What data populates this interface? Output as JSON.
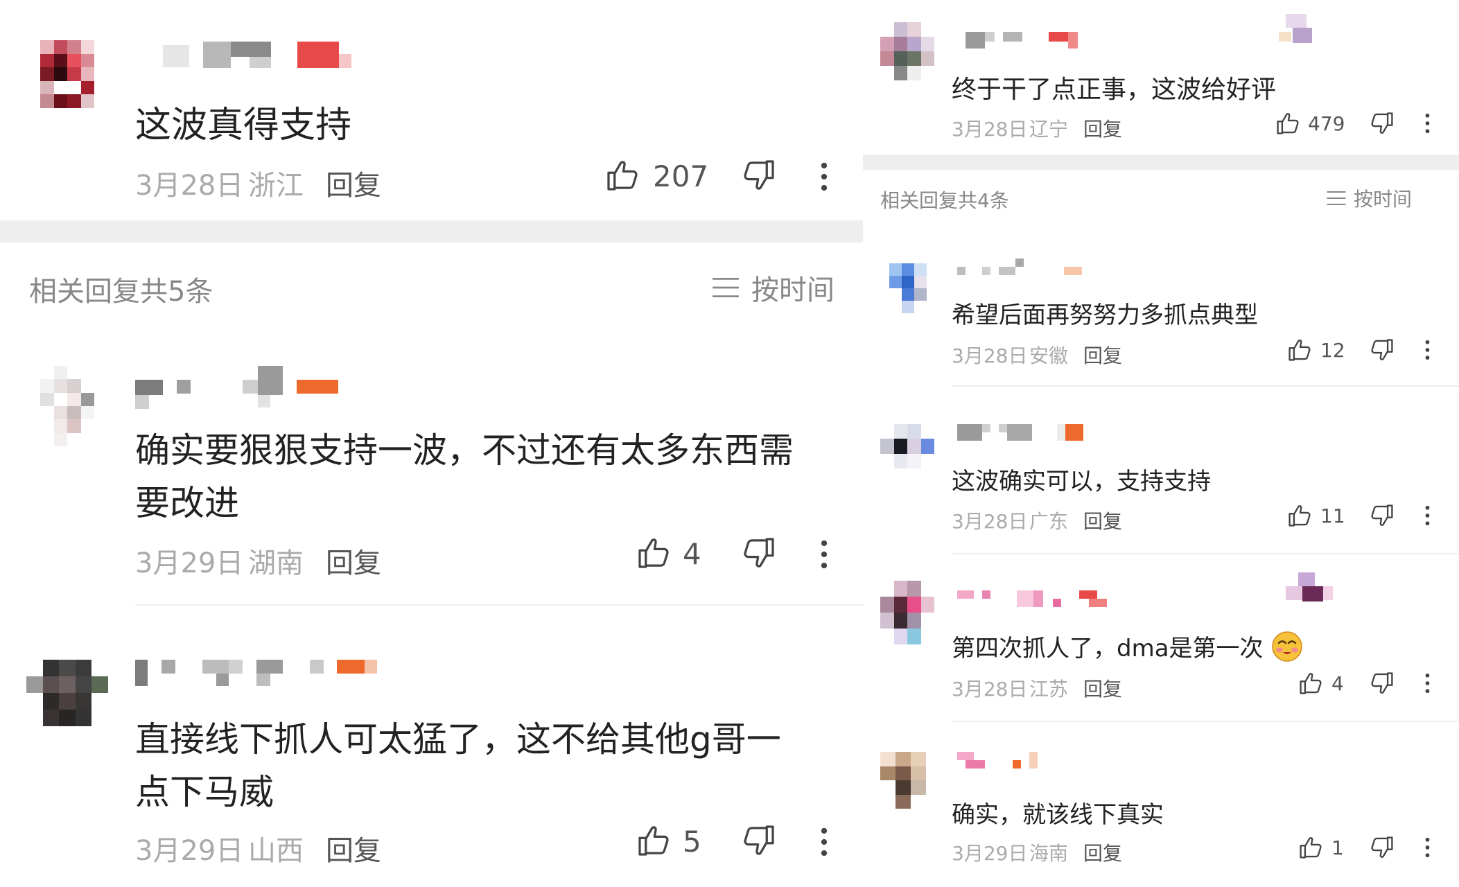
{
  "left": {
    "top_comment": {
      "text": "这波真得支持",
      "date": "3月28日",
      "location": "浙江",
      "reply": "回复",
      "likes": "207"
    },
    "section": {
      "title": "相关回复共5条",
      "sort": "按时间"
    },
    "replies": [
      {
        "text_line1": "确实要狠狠支持一波，不过还有太多东西需",
        "text_line2": "要改进",
        "date": "3月29日",
        "location": "湖南",
        "reply": "回复",
        "likes": "4"
      },
      {
        "text_line1": "直接线下抓人可太猛了，这不给其他g哥一",
        "text_line2": "点下马威",
        "date": "3月29日",
        "location": "山西",
        "reply": "回复",
        "likes": "5"
      }
    ]
  },
  "right": {
    "top_comment": {
      "text": "终于干了点正事，这波给好评",
      "date": "3月28日",
      "location": "辽宁",
      "reply": "回复",
      "likes": "479"
    },
    "section": {
      "title": "相关回复共4条",
      "sort": "按时间"
    },
    "replies": [
      {
        "text": "希望后面再努努力多抓点典型",
        "date": "3月28日",
        "location": "安徽",
        "reply": "回复",
        "likes": "12"
      },
      {
        "text": "这波确实可以，支持支持",
        "date": "3月28日",
        "location": "广东",
        "reply": "回复",
        "likes": "11"
      },
      {
        "text": "第四次抓人了，dma是第一次",
        "date": "3月28日",
        "location": "江苏",
        "reply": "回复",
        "likes": "4"
      },
      {
        "text": "确实，就该线下真实",
        "date": "3月29日",
        "location": "海南",
        "reply": "回复",
        "likes": "1"
      }
    ]
  },
  "icons": {
    "like": "thumbs-up-icon",
    "dislike": "thumbs-down-icon",
    "more": "more-vertical-icon",
    "sort": "list-sort-icon",
    "emoji": "blushing-face-emoji"
  },
  "colors": {
    "text": "#222222",
    "meta": "#aaaaaa",
    "band": "#eeeeee",
    "accent_orange": "#ee6a2c",
    "accent_red": "#e84a4a"
  }
}
